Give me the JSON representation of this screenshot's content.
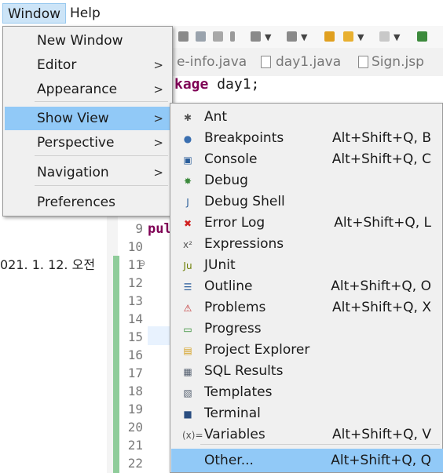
{
  "menubar": {
    "window": "Window",
    "help": "Help"
  },
  "tabs": [
    {
      "label": "e-info.java"
    },
    {
      "label": "day1.java"
    },
    {
      "label": "Sign.jsp"
    }
  ],
  "editor": {
    "pkg_keyword": "kage",
    "pkg_name": " day1;",
    "pub_fragment": "pul",
    "line_numbers": [
      "9",
      "10",
      "11",
      "12",
      "13",
      "14",
      "15",
      "16",
      "17",
      "18",
      "19",
      "20",
      "21",
      "22"
    ],
    "fold_marker": "⊖"
  },
  "left_panel": {
    "date_text": "021. 1. 12. 오전"
  },
  "window_menu": {
    "items": [
      {
        "label": "New Window",
        "submenu": false
      },
      {
        "label": "Editor",
        "submenu": true
      },
      {
        "label": "Appearance",
        "submenu": true
      },
      {
        "label": "Show View",
        "submenu": true,
        "selected": true
      },
      {
        "label": "Perspective",
        "submenu": true
      },
      {
        "label": "Navigation",
        "submenu": true
      },
      {
        "label": "Preferences",
        "submenu": false
      }
    ],
    "submenu_arrow": ">"
  },
  "show_view_menu": {
    "items": [
      {
        "label": "Ant",
        "shortcut": "",
        "icon": "ant-icon",
        "glyph": "✱",
        "color": "#555555"
      },
      {
        "label": "Breakpoints",
        "shortcut": "Alt+Shift+Q, B",
        "icon": "breakpoints-icon",
        "glyph": "●",
        "color": "#3a6fb0"
      },
      {
        "label": "Console",
        "shortcut": "Alt+Shift+Q, C",
        "icon": "console-icon",
        "glyph": "▣",
        "color": "#2a5d9a"
      },
      {
        "label": "Debug",
        "shortcut": "",
        "icon": "debug-icon",
        "glyph": "✸",
        "color": "#3c8a3c"
      },
      {
        "label": "Debug Shell",
        "shortcut": "",
        "icon": "debug-shell-icon",
        "glyph": "J",
        "color": "#2a5d9a"
      },
      {
        "label": "Error Log",
        "shortcut": "Alt+Shift+Q, L",
        "icon": "error-log-icon",
        "glyph": "✖",
        "color": "#d02020"
      },
      {
        "label": "Expressions",
        "shortcut": "",
        "icon": "expressions-icon",
        "glyph": "x²",
        "color": "#555555"
      },
      {
        "label": "JUnit",
        "shortcut": "",
        "icon": "junit-icon",
        "glyph": "Ju",
        "color": "#6b7d00"
      },
      {
        "label": "Outline",
        "shortcut": "Alt+Shift+Q, O",
        "icon": "outline-icon",
        "glyph": "☰",
        "color": "#2a5d9a"
      },
      {
        "label": "Problems",
        "shortcut": "Alt+Shift+Q, X",
        "icon": "problems-icon",
        "glyph": "⚠",
        "color": "#c03030"
      },
      {
        "label": "Progress",
        "shortcut": "",
        "icon": "progress-icon",
        "glyph": "▭",
        "color": "#2f8a2f"
      },
      {
        "label": "Project Explorer",
        "shortcut": "",
        "icon": "project-explorer-icon",
        "glyph": "▤",
        "color": "#d4a020"
      },
      {
        "label": "SQL Results",
        "shortcut": "",
        "icon": "sql-results-icon",
        "glyph": "▦",
        "color": "#556070"
      },
      {
        "label": "Templates",
        "shortcut": "",
        "icon": "templates-icon",
        "glyph": "▧",
        "color": "#556070"
      },
      {
        "label": "Terminal",
        "shortcut": "",
        "icon": "terminal-icon",
        "glyph": "■",
        "color": "#2a4d80"
      },
      {
        "label": "Variables",
        "shortcut": "Alt+Shift+Q, V",
        "icon": "variables-icon",
        "glyph": "(x)=",
        "color": "#555555"
      },
      {
        "label": "Other...",
        "shortcut": "Alt+Shift+Q, Q",
        "icon": "",
        "glyph": "",
        "color": "#555555",
        "selected": true
      }
    ]
  }
}
